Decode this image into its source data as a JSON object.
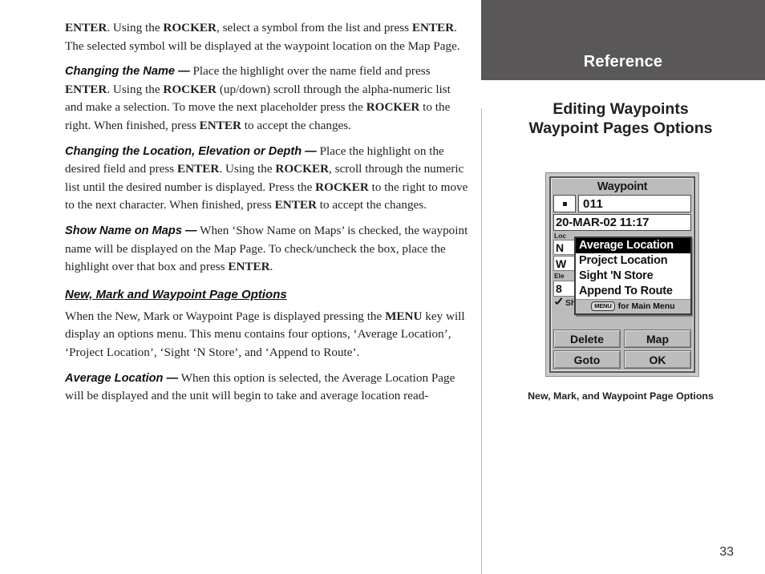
{
  "page": {
    "number": "33"
  },
  "header": {
    "section_label": "Reference",
    "bar_color": "#595757"
  },
  "sidebar": {
    "title_line1": "Editing Waypoints",
    "title_line2": "Waypoint Pages Options",
    "figure_caption": "New, Mark, and Waypoint Page Options"
  },
  "body": {
    "p1_a": "ENTER",
    "p1_b": ".  Using the ",
    "p1_c": "ROCKER",
    "p1_d": ", select a symbol from the list and press ",
    "p1_e": "ENTER",
    "p1_f": ".  The selected symbol will be displayed at the waypoint location on the Map Page.",
    "p2_head": "Changing the Name —",
    "p2_a": " Place the highlight over the name field and press ",
    "p2_b": "ENTER",
    "p2_c": ".  Using the ",
    "p2_d": "ROCKER",
    "p2_e": " (up/down) scroll through the alpha-numeric list and make a selection.  To move the next placeholder press the ",
    "p2_f": "ROCKER",
    "p2_g": " to the right.  When finished, press ",
    "p2_h": "ENTER",
    "p2_i": " to accept the changes.",
    "p3_head": "Changing the Location, Elevation or Depth —",
    "p3_a": " Place the highlight on the desired field and press ",
    "p3_b": "ENTER",
    "p3_c": ".  Using the ",
    "p3_d": "ROCKER",
    "p3_e": ", scroll through the numeric list until the desired number is displayed.  Press the ",
    "p3_f": "ROCKER",
    "p3_g": " to the right to move to the next character.  When finished, press ",
    "p3_h": "ENTER",
    "p3_i": " to accept the changes.",
    "p4_head": "Show Name on Maps —",
    "p4_a": "  When ‘Show Name on Maps’ is checked, the waypoint name will be displayed on the Map Page.  To check/uncheck the box, place the highlight over that box and press ",
    "p4_b": "ENTER",
    "p4_c": ".",
    "subhead": "New, Mark and Waypoint Page Options",
    "p5_a": "When the New, Mark or Waypoint Page is displayed pressing the ",
    "p5_b": "MENU",
    "p5_c": " key will display an options menu. This menu contains four options, ‘Average Location’, ‘Project Location’, ‘Sight ‘N Store’, and ‘Append to Route’.",
    "p6_head": "Average Location —",
    "p6_a": "  When this option is selected, the Average Location Page will be displayed and the unit will begin to take and average location read-"
  },
  "gps": {
    "screen_title": "Waypoint",
    "symbol_icon": "square-dot-symbol",
    "waypoint_name": "011",
    "datetime": "20-MAR-02 11:17",
    "location_label": "Loc",
    "lat_value": "N",
    "lon_value": "W",
    "elevation_label": "Ele",
    "elevation_value": "8",
    "show_name_label": "Show Name on Maps",
    "show_name_checked": true,
    "menu": {
      "items": [
        {
          "label": "Average Location",
          "selected": true
        },
        {
          "label": "Project Location",
          "selected": false
        },
        {
          "label": "Sight 'N Store",
          "selected": false
        },
        {
          "label": "Append To Route",
          "selected": false
        }
      ],
      "footer_key": "MENU",
      "footer_text": "for Main Menu"
    },
    "buttons": [
      {
        "label": "Delete"
      },
      {
        "label": "Map"
      },
      {
        "label": "Goto"
      },
      {
        "label": "OK"
      }
    ]
  }
}
